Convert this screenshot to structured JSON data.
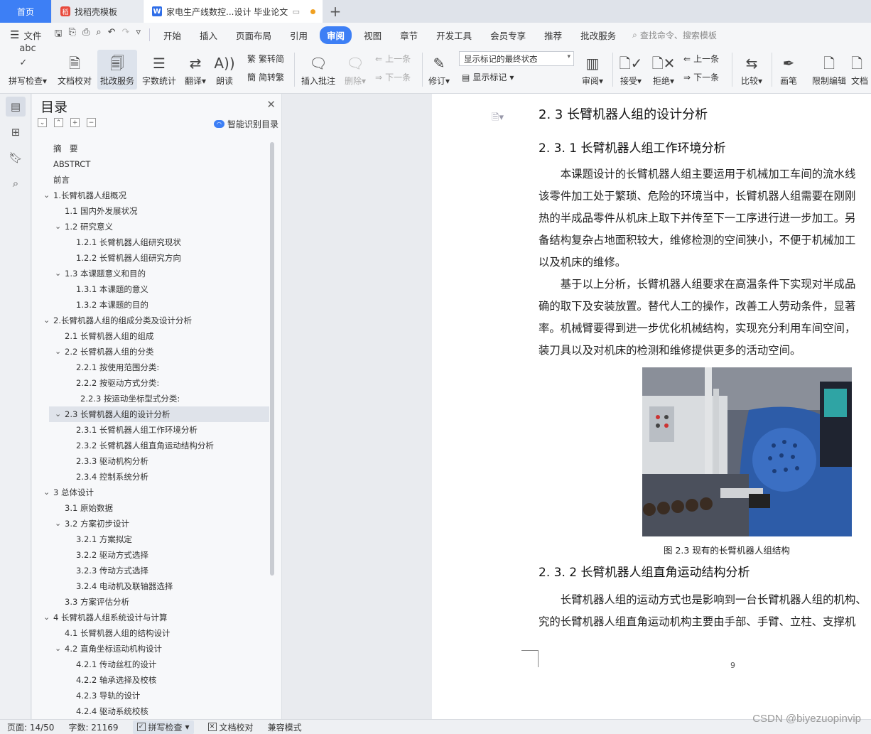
{
  "tabs": {
    "home": "首页",
    "template": "找稻壳模板",
    "doc": "家电生产线数控...设计 毕业论文"
  },
  "menu": {
    "file": "文件",
    "items": [
      "开始",
      "插入",
      "页面布局",
      "引用",
      "审阅",
      "视图",
      "章节",
      "开发工具",
      "会员专享",
      "推荐",
      "批改服务"
    ],
    "active_index": 4,
    "search_placeholder": "查找命令、搜索模板"
  },
  "ribbon": {
    "spell": "拼写检查",
    "doccheck": "文档校对",
    "correct": "批改服务",
    "wordcount": "字数统计",
    "translate": "翻译",
    "read": "朗读",
    "t2s": "繁转简",
    "s2t": "简转繁",
    "insert_comment": "插入批注",
    "delete": "删除",
    "prev": "上一条",
    "next": "下一条",
    "revise": "修订",
    "markup_state": "显示标记的最终状态",
    "show_markup": "显示标记",
    "review": "审阅",
    "accept": "接受",
    "reject": "拒绝",
    "prev2": "上一条",
    "next2": "下一条",
    "compare": "比较",
    "pen": "画笔",
    "restrict": "限制编辑",
    "doc_cut": "文档"
  },
  "toc": {
    "title": "目录",
    "smart": "智能识别目录",
    "items": [
      {
        "text": "摘　要",
        "level": 0
      },
      {
        "text": "ABSTRCT",
        "level": 0
      },
      {
        "text": "前言",
        "level": 0
      },
      {
        "text": "1.长臂机器人组概况",
        "level": 0,
        "exp": true
      },
      {
        "text": "1.1 国内外发展状况",
        "level": 1
      },
      {
        "text": "1.2 研究意义",
        "level": 1,
        "exp": true
      },
      {
        "text": "1.2.1 长臂机器人组研究现状",
        "level": 2
      },
      {
        "text": "1.2.2 长臂机器人组研究方向",
        "level": 2
      },
      {
        "text": "1.3 本课题意义和目的",
        "level": 1,
        "exp": true
      },
      {
        "text": "1.3.1 本课题的意义",
        "level": 2
      },
      {
        "text": "1.3.2 本课题的目的",
        "level": 2
      },
      {
        "text": "2.长臂机器人组的组成分类及设计分析",
        "level": 0,
        "exp": true
      },
      {
        "text": "2.1 长臂机器人组的组成",
        "level": 1
      },
      {
        "text": "2.2 长臂机器人组的分类",
        "level": 1,
        "exp": true
      },
      {
        "text": "2.2.1 按使用范围分类:",
        "level": 2
      },
      {
        "text": "2.2.2 按驱动方式分类:",
        "level": 2
      },
      {
        "text": "2.2.3 按运动坐标型式分类:",
        "level": 3
      },
      {
        "text": "2.3 长臂机器人组的设计分析",
        "level": 1,
        "exp": true,
        "sel": true
      },
      {
        "text": "2.3.1 长臂机器人组工作环境分析",
        "level": 2
      },
      {
        "text": "2.3.2 长臂机器人组直角运动结构分析",
        "level": 2
      },
      {
        "text": "2.3.3 驱动机构分析",
        "level": 2
      },
      {
        "text": "2.3.4 控制系统分析",
        "level": 2
      },
      {
        "text": "3 总体设计",
        "level": 0,
        "exp": true
      },
      {
        "text": "3.1 原始数据",
        "level": 1
      },
      {
        "text": "3.2 方案初步设计",
        "level": 1,
        "exp": true
      },
      {
        "text": "3.2.1 方案拟定",
        "level": 2
      },
      {
        "text": "3.2.2 驱动方式选择",
        "level": 2
      },
      {
        "text": "3.2.3 传动方式选择",
        "level": 2
      },
      {
        "text": "3.2.4 电动机及联轴器选择",
        "level": 2
      },
      {
        "text": "3.3 方案评估分析",
        "level": 1
      },
      {
        "text": "4 长臂机器人组系统设计与计算",
        "level": 0,
        "exp": true
      },
      {
        "text": "4.1 长臂机器人组的结构设计",
        "level": 1
      },
      {
        "text": "4.2 直角坐标运动机构设计",
        "level": 1,
        "exp": true
      },
      {
        "text": "4.2.1 传动丝杠的设计",
        "level": 2
      },
      {
        "text": "4.2.2 轴承选择及校核",
        "level": 2
      },
      {
        "text": "4.2.3 导轨的设计",
        "level": 2
      },
      {
        "text": "4.2.4 驱动系统校核",
        "level": 2
      }
    ]
  },
  "doc": {
    "h_2_3": "2. 3  长臂机器人组的设计分析",
    "h_2_3_1": "2. 3. 1 长臂机器人组工作环境分析",
    "p1": [
      "　　本课题设计的长臂机器人组主要运用于机械加工车间的流水线",
      "该零件加工处于繁琐、危险的环境当中，长臂机器人组需要在刚刚",
      "热的半成品零件从机床上取下并传至下一工序进行进一步加工。另",
      "备结构复杂占地面积较大，维修检测的空间狭小，不便于机械加工",
      "以及机床的维修。"
    ],
    "p2": [
      "　　基于以上分析，长臂机器人组要求在高温条件下实现对半成品",
      "确的取下及安装放置。替代人工的操作，改善工人劳动条件，显著",
      "率。机械臂要得到进一步优化机械结构，实现充分利用车间空间，",
      "装刀具以及对机床的检测和维修提供更多的活动空间。"
    ],
    "caption": "图 2.3  现有的长臂机器人组结构",
    "h_2_3_2": "2. 3. 2 长臂机器人组直角运动结构分析",
    "p3": [
      "　　长臂机器人组的运动方式也是影响到一台长臂机器人组的机构、",
      "究的长臂机器人组直角运动机构主要由手部、手臂、立柱、支撑机"
    ],
    "page_number": "9"
  },
  "status": {
    "page": "页面: 14/50",
    "words": "字数: 21169",
    "spell": "拼写检查",
    "doccheck": "文档校对",
    "compat": "兼容模式"
  },
  "watermark": "CSDN @biyezuopinvip"
}
